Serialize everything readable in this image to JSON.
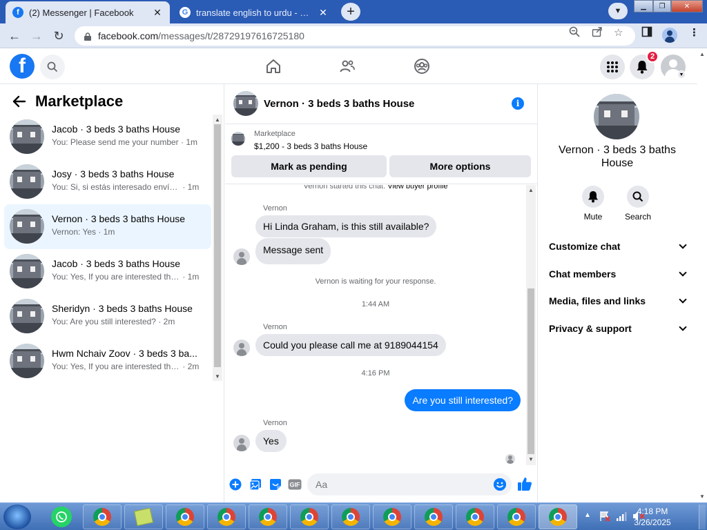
{
  "browser": {
    "tabs": [
      {
        "title": "(2) Messenger | Facebook",
        "active": true,
        "favicon": "facebook-icon"
      },
      {
        "title": "translate english to urdu - Google",
        "active": false,
        "favicon": "google-icon"
      }
    ],
    "url_host": "facebook.com",
    "url_path": "/messages/t/28729197616725180"
  },
  "fb_header": {
    "notification_count": "2",
    "icons": [
      "home-icon",
      "friends-icon",
      "groups-icon",
      "menu-grid-icon",
      "bell-icon",
      "account-avatar"
    ]
  },
  "left_panel": {
    "title": "Marketplace",
    "conversations": [
      {
        "name": "Jacob · 3 beds 3 baths House",
        "preview": "You: Please send me your number",
        "time": "1m",
        "selected": false
      },
      {
        "name": "Josy · 3 beds 3 baths House",
        "preview": "You: Si, si estás interesado envíam...",
        "time": "1m",
        "selected": false
      },
      {
        "name": "Vernon · 3 beds 3 baths House",
        "preview": "Vernon: Yes",
        "time": "1m",
        "selected": true
      },
      {
        "name": "Jacob · 3 beds 3 baths House",
        "preview": "You: Yes, If you are interested then...",
        "time": "1m",
        "selected": false
      },
      {
        "name": "Sheridyn · 3 beds 3 baths House",
        "preview": "You: Are you still interested?",
        "time": "2m",
        "selected": false
      },
      {
        "name": "Hwm Nchaiv Zoov · 3 beds 3 ba...",
        "preview": "You: Yes, If you are interested then...",
        "time": "2m",
        "selected": false
      }
    ]
  },
  "chat": {
    "title": "Vernon · 3 beds 3 baths House",
    "listing": {
      "label": "Marketplace",
      "price_title": "$1,200 - 3 beds 3 baths House",
      "mark_pending": "Mark as pending",
      "more_options": "More options"
    },
    "started_text": "Vernon started this chat.",
    "view_profile": "View buyer profile",
    "messages": {
      "m1_sender": "Vernon",
      "m1_text": "Hi Linda Graham, is this still available?",
      "m2_text": "Message sent",
      "waiting": "Vernon is waiting for your response.",
      "time1": "1:44 AM",
      "m3_sender": "Vernon",
      "m3_text": "Could you please call me at 9189044154",
      "time2": "4:16 PM",
      "m4_text": "Are you still interested?",
      "m5_sender": "Vernon",
      "m5_text": "Yes"
    },
    "input_placeholder": "Aa"
  },
  "right_panel": {
    "title": "Vernon · 3 beds 3 baths House",
    "mute": "Mute",
    "search": "Search",
    "rows": [
      "Customize chat",
      "Chat members",
      "Media, files and links",
      "Privacy & support"
    ]
  },
  "taskbar": {
    "time": "4:18 PM",
    "date": "3/26/2025"
  },
  "colors": {
    "fb_blue": "#1877f2",
    "messenger_blue": "#0a7cff",
    "selected_row": "#ebf5ff",
    "notification_red": "#e41e3f"
  }
}
